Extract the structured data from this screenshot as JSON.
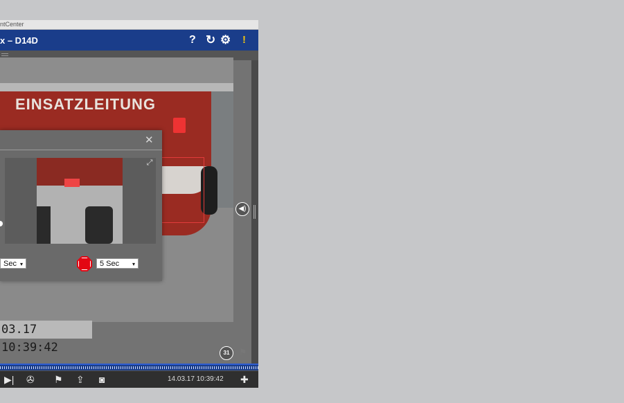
{
  "window": {
    "titlebar_text": "ntCenter",
    "header_title": "x – D14D",
    "header_icons": [
      "help-icon",
      "reload-icon",
      "gear-icon",
      "alarm-bell-icon"
    ],
    "help_glyph": "?",
    "reload_glyph": "↻",
    "gear_glyph": "⚙",
    "bell_glyph": "!"
  },
  "video": {
    "lettering": "EINSATZLEITUNG",
    "timestamp": "03.17 10:39:42"
  },
  "panel": {
    "close_glyph": "✕",
    "expand_glyph": "⤢",
    "pre_select_value": "Sec",
    "post_select_value": "5 Sec",
    "caret": "▾"
  },
  "side": {
    "speaker_glyph": "◀)",
    "calendar_label": "31"
  },
  "toolbar": {
    "icons": [
      "step-forward-icon",
      "film-reel-icon",
      "flag-icon",
      "share-icon",
      "snapshot-icon",
      "pin-icon"
    ],
    "step_glyph": "▶|",
    "reel_glyph": "✇",
    "flag_glyph": "⚑",
    "share_glyph": "⇪",
    "snapshot_glyph": "◙",
    "pin_glyph": "✚",
    "time": "14.03.17 10:39:42"
  },
  "colors": {
    "header_blue": "#1a3d8a",
    "record_red": "#e30613",
    "alarm_yellow": "#f1c40f"
  }
}
